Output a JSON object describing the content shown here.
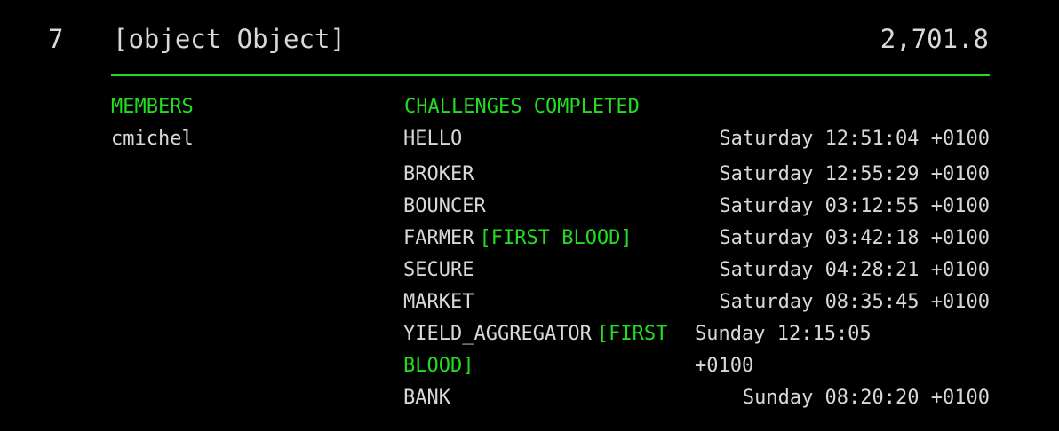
{
  "team": {
    "rank": "7",
    "name": "[object Object]",
    "score": "2,701.8"
  },
  "colors": {
    "background": "#000000",
    "text": "#d8d8d8",
    "accent": "#22dd22"
  },
  "members": {
    "heading": "MEMBERS",
    "list": [
      "cmichel"
    ]
  },
  "challenges": {
    "heading": "CHALLENGES COMPLETED",
    "rows": [
      {
        "name": "HELLO",
        "badge": "",
        "time": "Saturday 12:51:04 +0100"
      },
      {
        "name": "BROKER",
        "badge": "",
        "time": "Saturday 12:55:29 +0100"
      },
      {
        "name": "BOUNCER",
        "badge": "",
        "time": "Saturday 03:12:55 +0100"
      },
      {
        "name": "FARMER",
        "badge": "[FIRST BLOOD]",
        "time": "Saturday 03:42:18 +0100"
      },
      {
        "name": "SECURE",
        "badge": "",
        "time": "Saturday 04:28:21 +0100"
      },
      {
        "name": "MARKET",
        "badge": "",
        "time": "Saturday 08:35:45 +0100"
      },
      {
        "name": "YIELD_AGGREGATOR",
        "badge": "[FIRST BLOOD]",
        "time": "Sunday 12:15:05 +0100"
      },
      {
        "name": "BANK",
        "badge": "",
        "time": "Sunday 08:20:20 +0100"
      }
    ]
  }
}
